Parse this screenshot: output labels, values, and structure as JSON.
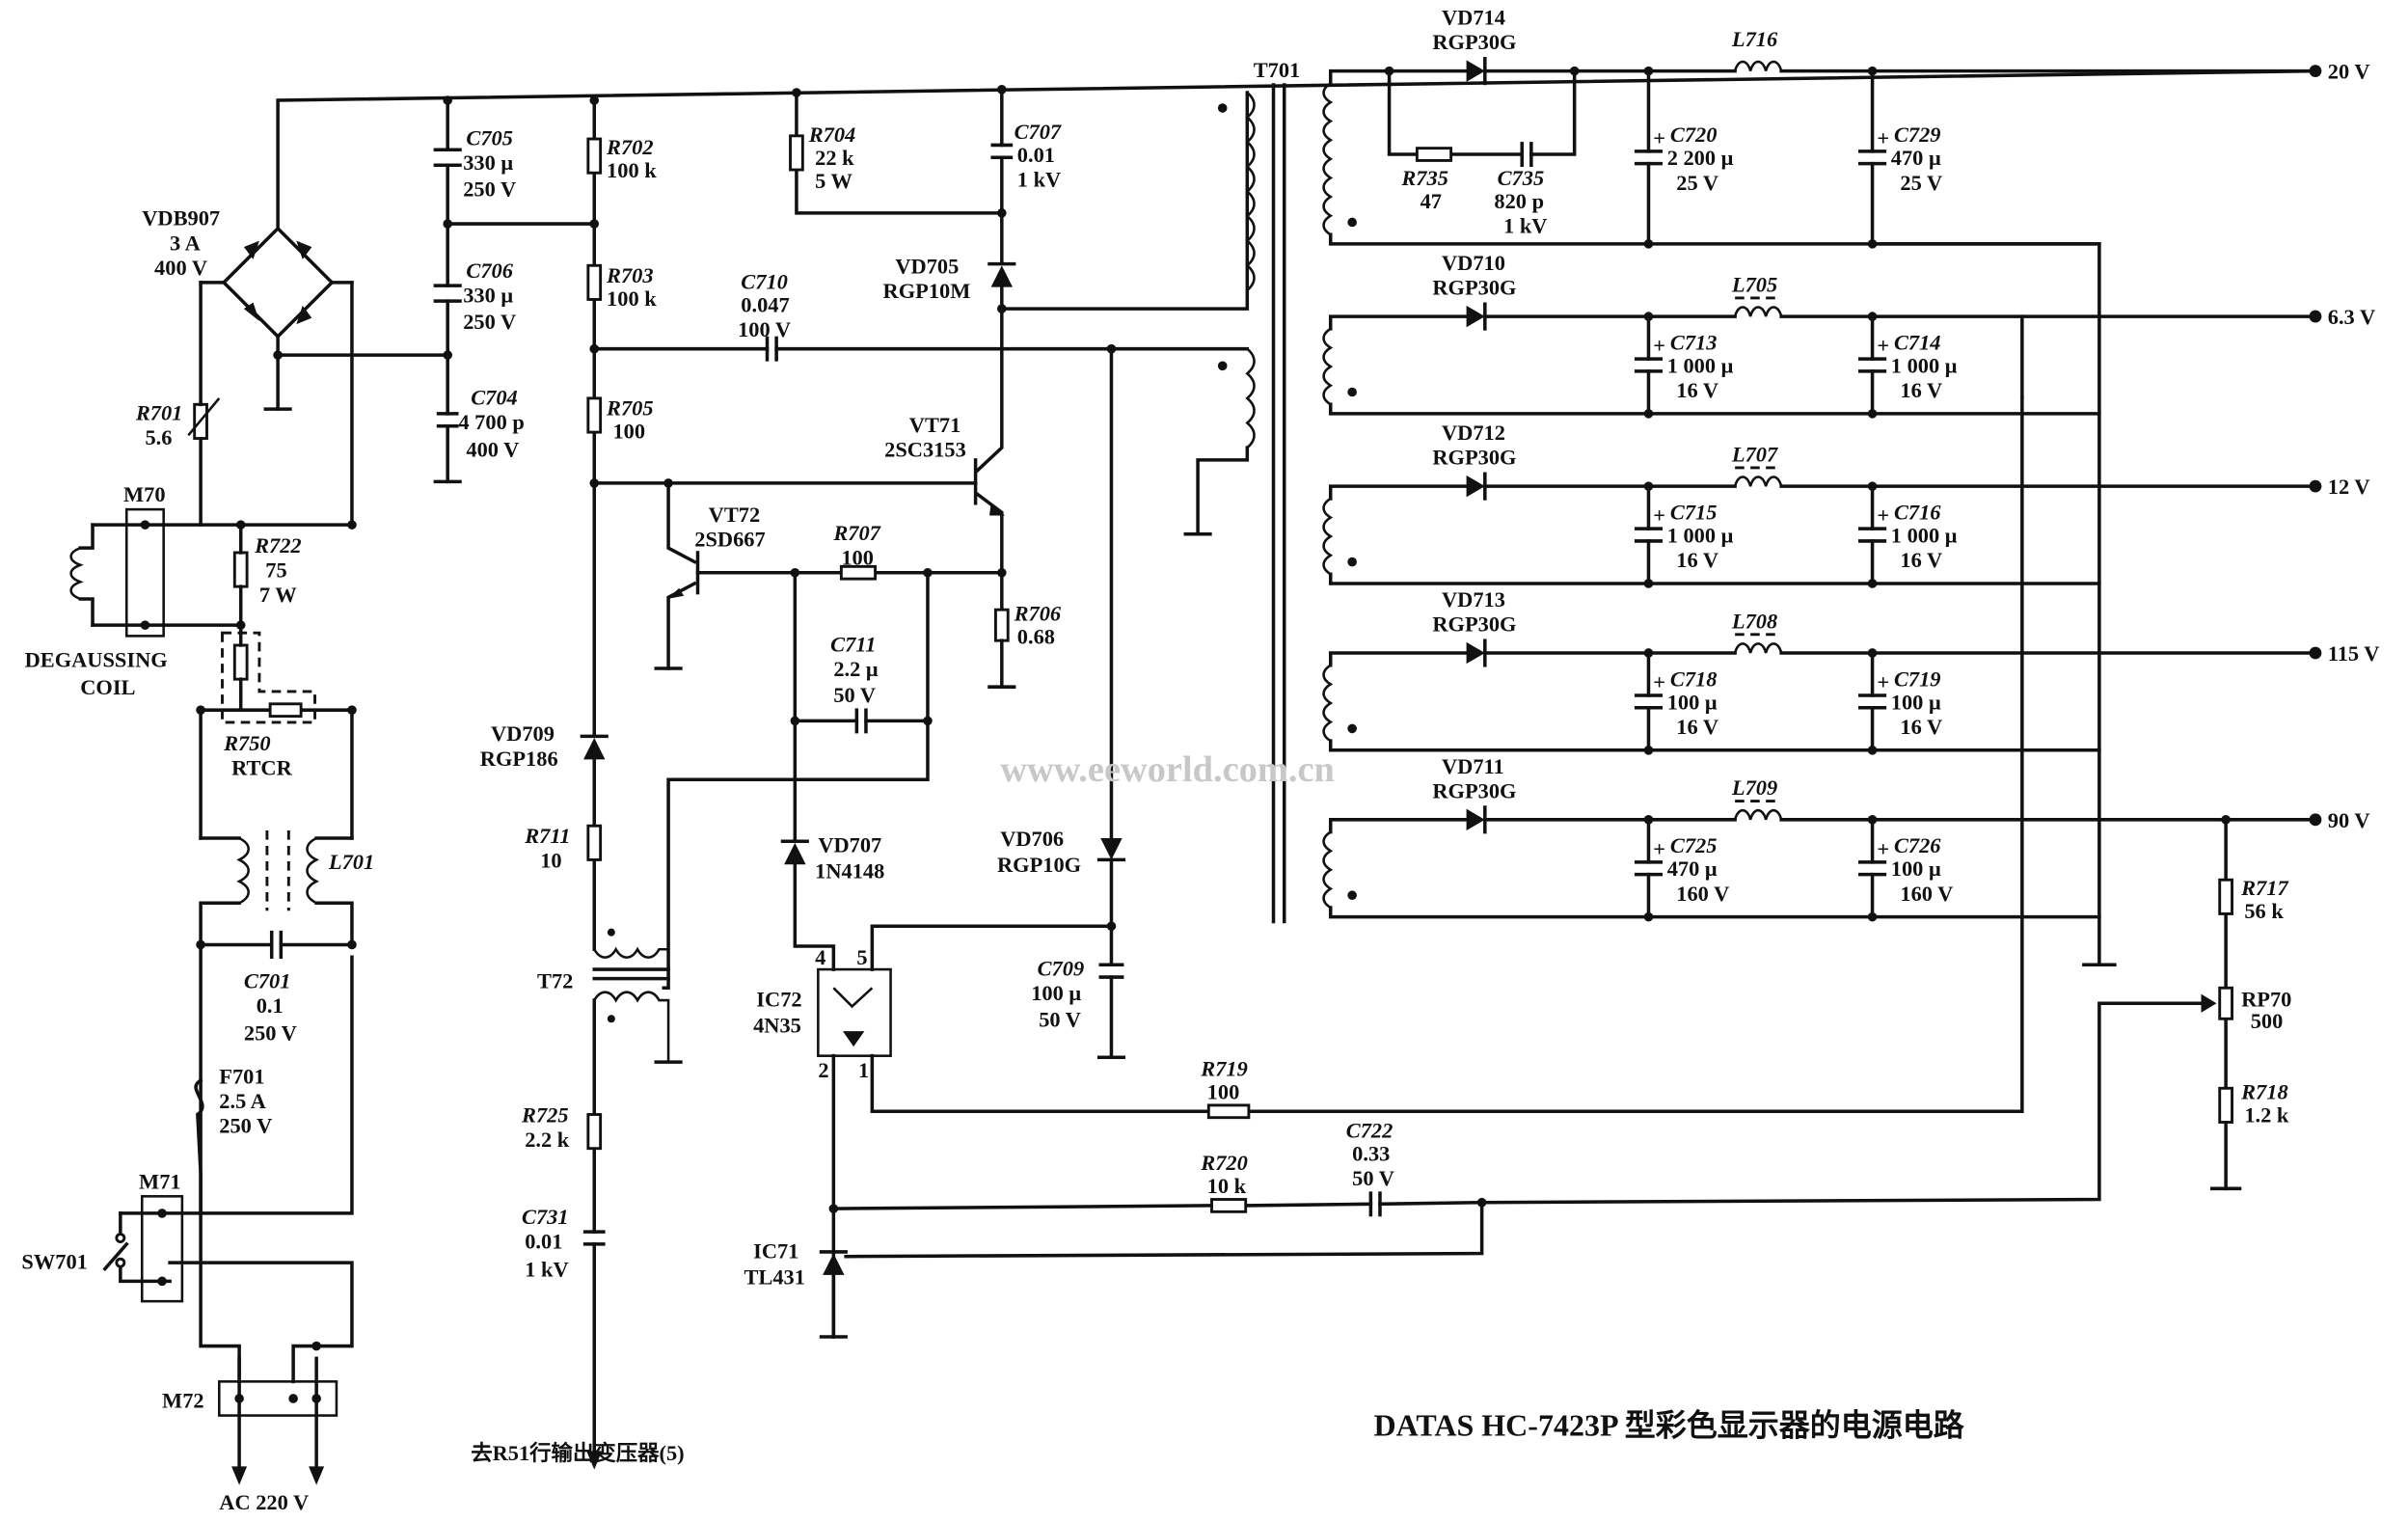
{
  "title": "DATAS HC-7423P 型彩色显示器的电源电路",
  "watermark": "www.eeworld.com.cn",
  "input": {
    "ac_label": "AC 220 V",
    "m72": "M72",
    "m71": "M71",
    "sw701": "SW701",
    "m70": "M70",
    "degauss_1": "DEGAUSSING",
    "degauss_2": "COIL"
  },
  "components": {
    "vdb907": {
      "ref": "VDB907",
      "v1": "3 A",
      "v2": "400 V"
    },
    "r701": {
      "ref": "R701",
      "v1": "5.6"
    },
    "r722": {
      "ref": "R722",
      "v1": "75",
      "v2": "7 W"
    },
    "r750": {
      "ref": "R750",
      "v1": "RTCR"
    },
    "l701": {
      "ref": "L701"
    },
    "c701": {
      "ref": "C701",
      "v1": "0.1",
      "v2": "250 V"
    },
    "f701": {
      "ref": "F701",
      "v1": "2.5 A",
      "v2": "250 V"
    },
    "c705": {
      "ref": "C705",
      "v1": "330 μ",
      "v2": "250 V"
    },
    "c706": {
      "ref": "C706",
      "v1": "330 μ",
      "v2": "250 V"
    },
    "c704": {
      "ref": "C704",
      "v1": "4 700 p",
      "v2": "400 V"
    },
    "r702": {
      "ref": "R702",
      "v1": "100 k"
    },
    "r703": {
      "ref": "R703",
      "v1": "100 k"
    },
    "r705": {
      "ref": "R705",
      "v1": "100"
    },
    "r704": {
      "ref": "R704",
      "v1": "22 k",
      "v2": "5 W"
    },
    "c707": {
      "ref": "C707",
      "v1": "0.01",
      "v2": "1 kV"
    },
    "vd705": {
      "ref": "VD705",
      "v1": "RGP10M"
    },
    "c710": {
      "ref": "C710",
      "v1": "0.047",
      "v2": "100 V"
    },
    "vt71": {
      "ref": "VT71",
      "v1": "2SC3153"
    },
    "vt72": {
      "ref": "VT72",
      "v1": "2SD667"
    },
    "r707": {
      "ref": "R707",
      "v1": "100"
    },
    "r706": {
      "ref": "R706",
      "v1": "0.68"
    },
    "c711": {
      "ref": "C711",
      "v1": "2.2 μ",
      "v2": "50 V"
    },
    "vd709": {
      "ref": "VD709",
      "v1": "RGP186"
    },
    "r711": {
      "ref": "R711",
      "v1": "10"
    },
    "t72": {
      "ref": "T72"
    },
    "vd707": {
      "ref": "VD707",
      "v1": "1N4148"
    },
    "vd706": {
      "ref": "VD706",
      "v1": "RGP10G"
    },
    "c709": {
      "ref": "C709",
      "v1": "100 μ",
      "v2": "50 V"
    },
    "ic72": {
      "ref": "IC72",
      "v1": "4N35",
      "pin4": "4",
      "pin5": "5",
      "pin2": "2",
      "pin1": "1"
    },
    "r725": {
      "ref": "R725",
      "v1": "2.2 k"
    },
    "c731": {
      "ref": "C731",
      "v1": "0.01",
      "v2": "1 kV"
    },
    "hv_note": "去R51行输出变压器(5)",
    "r719": {
      "ref": "R719",
      "v1": "100"
    },
    "r720": {
      "ref": "R720",
      "v1": "10 k"
    },
    "c722": {
      "ref": "C722",
      "v1": "0.33",
      "v2": "50 V"
    },
    "ic71": {
      "ref": "IC71",
      "v1": "TL431"
    },
    "t701": {
      "ref": "T701"
    },
    "r717": {
      "ref": "R717",
      "v1": "56 k"
    },
    "rp70": {
      "ref": "RP70",
      "v1": "500"
    },
    "r718": {
      "ref": "R718",
      "v1": "1.2 k"
    }
  },
  "outputs": [
    {
      "diode": "VD714",
      "diode_type": "RGP30G",
      "inductor": "L716",
      "voltage": "20 V",
      "c1": {
        "ref": "C720",
        "v1": "2 200 μ",
        "v2": "25 V"
      },
      "c2": {
        "ref": "C729",
        "v1": "470 μ",
        "v2": "25 V"
      },
      "snubber_r": {
        "ref": "R735",
        "v1": "47"
      },
      "snubber_c": {
        "ref": "C735",
        "v1": "820 p",
        "v2": "1 kV"
      }
    },
    {
      "diode": "VD710",
      "diode_type": "RGP30G",
      "inductor": "L705",
      "voltage": "6.3 V",
      "c1": {
        "ref": "C713",
        "v1": "1 000 μ",
        "v2": "16 V"
      },
      "c2": {
        "ref": "C714",
        "v1": "1 000 μ",
        "v2": "16 V"
      }
    },
    {
      "diode": "VD712",
      "diode_type": "RGP30G",
      "inductor": "L707",
      "voltage": "12 V",
      "c1": {
        "ref": "C715",
        "v1": "1 000 μ",
        "v2": "16 V"
      },
      "c2": {
        "ref": "C716",
        "v1": "1 000 μ",
        "v2": "16 V"
      }
    },
    {
      "diode": "VD713",
      "diode_type": "RGP30G",
      "inductor": "L708",
      "voltage": "115 V",
      "c1": {
        "ref": "C718",
        "v1": "100 μ",
        "v2": "16 V"
      },
      "c2": {
        "ref": "C719",
        "v1": "100 μ",
        "v2": "16 V"
      }
    },
    {
      "diode": "VD711",
      "diode_type": "RGP30G",
      "inductor": "L709",
      "voltage": "90 V",
      "c1": {
        "ref": "C725",
        "v1": "470 μ",
        "v2": "160 V"
      },
      "c2": {
        "ref": "C726",
        "v1": "100 μ",
        "v2": "160 V"
      }
    }
  ]
}
